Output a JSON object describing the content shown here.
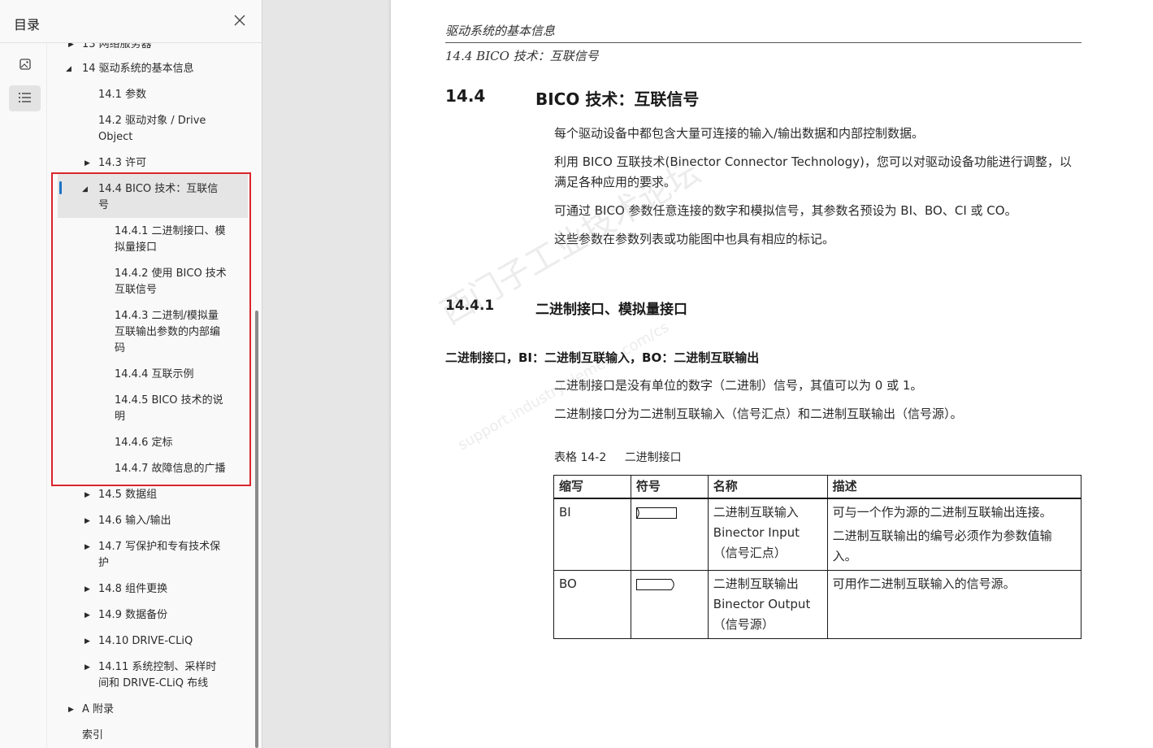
{
  "sidebar": {
    "title": "目录",
    "close_icon": "close-icon",
    "rail": [
      {
        "icon": "thumbnail-icon",
        "active": false
      },
      {
        "icon": "outline-list-icon",
        "active": true
      }
    ],
    "toc": [
      {
        "label": "13 网络服务器",
        "arrow": "▶"
      },
      {
        "label": "14 驱动系统的基本信息",
        "arrow": "◢"
      },
      {
        "label": "14.1 参数",
        "arrow": ""
      },
      {
        "label": "14.2 驱动对象 / Drive",
        "label2": "Object",
        "arrow": ""
      },
      {
        "label": "14.3 许可",
        "arrow": "▶"
      },
      {
        "label": "14.4 BICO 技术：互联信",
        "label2": "号",
        "arrow": "◢"
      },
      {
        "label": "14.4.1 二进制接口、模",
        "label2": "拟量接口",
        "arrow": ""
      },
      {
        "label": "14.4.2 使用 BICO 技术",
        "label2": "互联信号",
        "arrow": ""
      },
      {
        "label": "14.4.3 二进制/模拟量",
        "label2": "互联输出参数的内部编",
        "label3": "码",
        "arrow": ""
      },
      {
        "label": "14.4.4 互联示例",
        "arrow": ""
      },
      {
        "label": "14.4.5 BICO 技术的说",
        "label2": "明",
        "arrow": ""
      },
      {
        "label": "14.4.6 定标",
        "arrow": ""
      },
      {
        "label": "14.4.7 故障信息的广播",
        "arrow": ""
      },
      {
        "label": "14.5 数据组",
        "arrow": "▶"
      },
      {
        "label": "14.6 输入/输出",
        "arrow": "▶"
      },
      {
        "label": "14.7 写保护和专有技术保",
        "label2": "护",
        "arrow": "▶"
      },
      {
        "label": "14.8 组件更换",
        "arrow": "▶"
      },
      {
        "label": "14.9 数据备份",
        "arrow": "▶"
      },
      {
        "label": "14.10 DRIVE-CLiQ",
        "arrow": "▶"
      },
      {
        "label": "14.11 系统控制、采样时",
        "label2": "间和 DRIVE-CLiQ 布线",
        "arrow": "▶"
      },
      {
        "label": "A 附录",
        "arrow": "▶"
      },
      {
        "label": "索引",
        "arrow": ""
      }
    ]
  },
  "document": {
    "running_header": "驱动系统的基本信息",
    "running_subheader": "14.4 BICO 技术：互联信号",
    "section": {
      "number": "14.4",
      "title": "BICO 技术：互联信号"
    },
    "intro": [
      "每个驱动设备中都包含大量可连接的输入/输出数据和内部控制数据。",
      "利用 BICO 互联技术(Binector Connector Technology)，您可以对驱动设备功能进行调整，以满足各种应用的要求。",
      "可通过 BICO 参数任意连接的数字和模拟信号，其参数名预设为 BI、BO、CI 或 CO。",
      "这些参数在参数列表或功能图中也具有相应的标记。"
    ],
    "subsection": {
      "number": "14.4.1",
      "title": "二进制接口、模拟量接口"
    },
    "bold_heading": "二进制接口，BI：二进制互联输入，BO：二进制互联输出",
    "body": [
      "二进制接口是没有单位的数字（二进制）信号，其值可以为 0 或 1。",
      "二进制接口分为二进制互联输入（信号汇点）和二进制互联输出（信号源）。"
    ],
    "table": {
      "caption_num": "表格 14-2",
      "caption_title": "二进制接口",
      "headers": [
        "缩写",
        "符号",
        "名称",
        "描述"
      ],
      "rows": [
        {
          "abbr": "BI",
          "symbol": "binector-input-symbol",
          "name": [
            "二进制互联输入",
            "Binector Input",
            "（信号汇点）"
          ],
          "desc": [
            "可与一个作为源的二进制互联输出连接。",
            "二进制互联输出的编号必须作为参数值输入。"
          ]
        },
        {
          "abbr": "BO",
          "symbol": "binector-output-symbol",
          "name": [
            "二进制互联输出",
            "Binector Output",
            "（信号源）"
          ],
          "desc": [
            "可用作二进制互联输入的信号源。"
          ]
        }
      ]
    },
    "watermark": "西门子工业技术论坛",
    "watermark_url": "support.industry.siemens.com/cs"
  }
}
